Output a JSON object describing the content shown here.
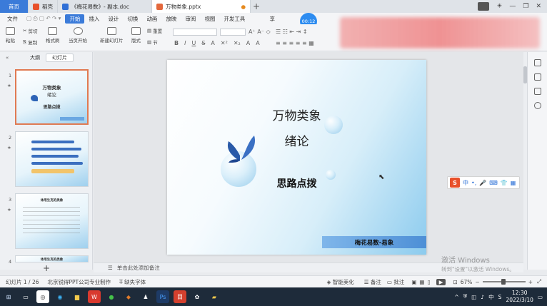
{
  "tabs": {
    "home": "首页",
    "daoke": "稻壳",
    "doc": "《梅花易数》- 副本.doc",
    "pptx": "万物类象.pptx",
    "new_tab": "+"
  },
  "menu": {
    "file": "文件",
    "start": "开始",
    "insert": "插入",
    "design": "设计",
    "switch": "切换",
    "animation": "动画",
    "slideshow": "放映",
    "review": "审阅",
    "view": "视图",
    "devtools": "开发工具",
    "share": "享"
  },
  "timer": "00:12",
  "ribbon": {
    "paste": "粘贴",
    "cut": "剪切",
    "copy": "复制",
    "format_painter": "格式刷",
    "play_from_current": "当页开始",
    "new_slide": "新建幻灯片",
    "layout": "版式",
    "reset": "重置",
    "section": "节"
  },
  "panel": {
    "collapse": "«",
    "outline_tab": "大纲",
    "slides_tab": "幻灯片",
    "add_slide": "+"
  },
  "thumbnails": [
    {
      "num": "1",
      "title1": "万物类象",
      "title2": "绪论",
      "sub": "思路点拨"
    },
    {
      "num": "2"
    },
    {
      "num": "3",
      "title1": "体用生克的类象"
    },
    {
      "num": "4",
      "title1": "体用生克的类象"
    }
  ],
  "slide": {
    "title_line1": "万物类象",
    "title_line2": "绪论",
    "subtitle": "思路点拨",
    "footer": "梅花易数-易象"
  },
  "notes_placeholder": "单击此处添加备注",
  "watermark": {
    "line1": "激活 Windows",
    "line2": "转到\"设置\"以激活 Windows。"
  },
  "status": {
    "slide_count": "幻灯片 1 / 26",
    "company": "北京锐得PPT公司专业制作",
    "missing_font": "缺失字体",
    "smart_beautify": "智能美化",
    "notes": "备注",
    "comments": "批注",
    "zoom": "67%"
  },
  "ime": {
    "logo": "S",
    "lang": "中"
  },
  "taskbar": {
    "time": "12:30",
    "date": "2022/3/10",
    "lang": "中"
  },
  "colors": {
    "accent": "#3b7bd9",
    "slide_footer": "#5c9be0",
    "taskbar": "#1e2b3a"
  }
}
